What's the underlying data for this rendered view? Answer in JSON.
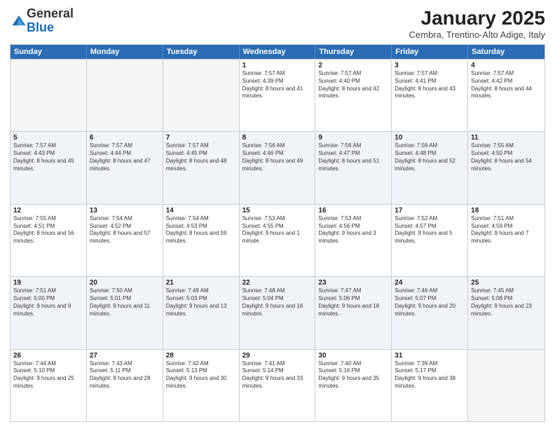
{
  "logo": {
    "general": "General",
    "blue": "Blue"
  },
  "header": {
    "month": "January 2025",
    "location": "Cembra, Trentino-Alto Adige, Italy"
  },
  "weekdays": [
    "Sunday",
    "Monday",
    "Tuesday",
    "Wednesday",
    "Thursday",
    "Friday",
    "Saturday"
  ],
  "rows": [
    [
      {
        "day": "",
        "info": "",
        "empty": true
      },
      {
        "day": "",
        "info": "",
        "empty": true
      },
      {
        "day": "",
        "info": "",
        "empty": true
      },
      {
        "day": "1",
        "info": "Sunrise: 7:57 AM\nSunset: 4:39 PM\nDaylight: 8 hours and 41 minutes."
      },
      {
        "day": "2",
        "info": "Sunrise: 7:57 AM\nSunset: 4:40 PM\nDaylight: 8 hours and 42 minutes."
      },
      {
        "day": "3",
        "info": "Sunrise: 7:57 AM\nSunset: 4:41 PM\nDaylight: 8 hours and 43 minutes."
      },
      {
        "day": "4",
        "info": "Sunrise: 7:57 AM\nSunset: 4:42 PM\nDaylight: 8 hours and 44 minutes."
      }
    ],
    [
      {
        "day": "5",
        "info": "Sunrise: 7:57 AM\nSunset: 4:43 PM\nDaylight: 8 hours and 45 minutes."
      },
      {
        "day": "6",
        "info": "Sunrise: 7:57 AM\nSunset: 4:44 PM\nDaylight: 8 hours and 47 minutes."
      },
      {
        "day": "7",
        "info": "Sunrise: 7:57 AM\nSunset: 4:45 PM\nDaylight: 8 hours and 48 minutes."
      },
      {
        "day": "8",
        "info": "Sunrise: 7:56 AM\nSunset: 4:46 PM\nDaylight: 8 hours and 49 minutes."
      },
      {
        "day": "9",
        "info": "Sunrise: 7:56 AM\nSunset: 4:47 PM\nDaylight: 8 hours and 51 minutes."
      },
      {
        "day": "10",
        "info": "Sunrise: 7:56 AM\nSunset: 4:48 PM\nDaylight: 8 hours and 52 minutes."
      },
      {
        "day": "11",
        "info": "Sunrise: 7:55 AM\nSunset: 4:50 PM\nDaylight: 8 hours and 54 minutes."
      }
    ],
    [
      {
        "day": "12",
        "info": "Sunrise: 7:55 AM\nSunset: 4:51 PM\nDaylight: 8 hours and 56 minutes."
      },
      {
        "day": "13",
        "info": "Sunrise: 7:54 AM\nSunset: 4:52 PM\nDaylight: 8 hours and 57 minutes."
      },
      {
        "day": "14",
        "info": "Sunrise: 7:54 AM\nSunset: 4:53 PM\nDaylight: 8 hours and 59 minutes."
      },
      {
        "day": "15",
        "info": "Sunrise: 7:53 AM\nSunset: 4:55 PM\nDaylight: 9 hours and 1 minute."
      },
      {
        "day": "16",
        "info": "Sunrise: 7:53 AM\nSunset: 4:56 PM\nDaylight: 9 hours and 3 minutes."
      },
      {
        "day": "17",
        "info": "Sunrise: 7:52 AM\nSunset: 4:57 PM\nDaylight: 9 hours and 5 minutes."
      },
      {
        "day": "18",
        "info": "Sunrise: 7:51 AM\nSunset: 4:59 PM\nDaylight: 9 hours and 7 minutes."
      }
    ],
    [
      {
        "day": "19",
        "info": "Sunrise: 7:51 AM\nSunset: 5:00 PM\nDaylight: 9 hours and 9 minutes."
      },
      {
        "day": "20",
        "info": "Sunrise: 7:50 AM\nSunset: 5:01 PM\nDaylight: 9 hours and 11 minutes."
      },
      {
        "day": "21",
        "info": "Sunrise: 7:49 AM\nSunset: 5:03 PM\nDaylight: 9 hours and 13 minutes."
      },
      {
        "day": "22",
        "info": "Sunrise: 7:48 AM\nSunset: 5:04 PM\nDaylight: 9 hours and 16 minutes."
      },
      {
        "day": "23",
        "info": "Sunrise: 7:47 AM\nSunset: 5:06 PM\nDaylight: 9 hours and 18 minutes."
      },
      {
        "day": "24",
        "info": "Sunrise: 7:46 AM\nSunset: 5:07 PM\nDaylight: 9 hours and 20 minutes."
      },
      {
        "day": "25",
        "info": "Sunrise: 7:45 AM\nSunset: 5:08 PM\nDaylight: 9 hours and 23 minutes."
      }
    ],
    [
      {
        "day": "26",
        "info": "Sunrise: 7:44 AM\nSunset: 5:10 PM\nDaylight: 9 hours and 25 minutes."
      },
      {
        "day": "27",
        "info": "Sunrise: 7:43 AM\nSunset: 5:11 PM\nDaylight: 9 hours and 28 minutes."
      },
      {
        "day": "28",
        "info": "Sunrise: 7:42 AM\nSunset: 5:13 PM\nDaylight: 9 hours and 30 minutes."
      },
      {
        "day": "29",
        "info": "Sunrise: 7:41 AM\nSunset: 5:14 PM\nDaylight: 9 hours and 33 minutes."
      },
      {
        "day": "30",
        "info": "Sunrise: 7:40 AM\nSunset: 5:16 PM\nDaylight: 9 hours and 35 minutes."
      },
      {
        "day": "31",
        "info": "Sunrise: 7:39 AM\nSunset: 5:17 PM\nDaylight: 9 hours and 38 minutes."
      },
      {
        "day": "",
        "info": "",
        "empty": true
      }
    ]
  ]
}
